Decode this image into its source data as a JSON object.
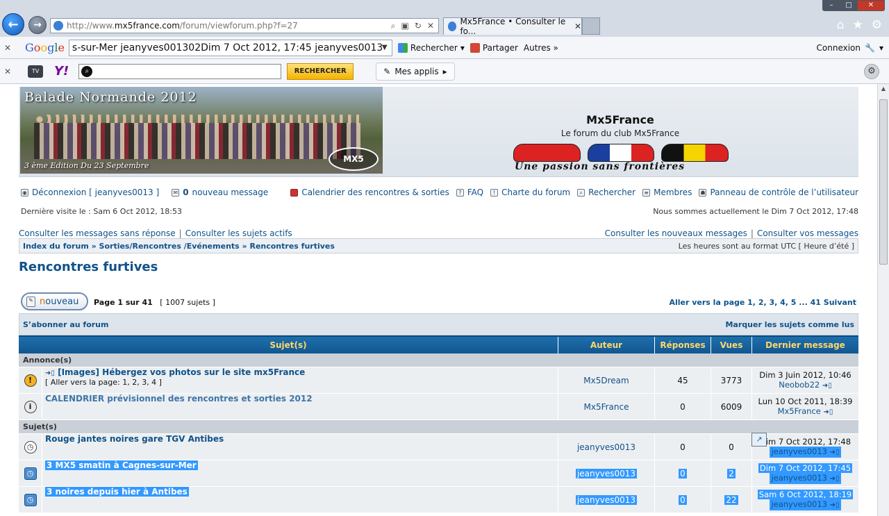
{
  "browser": {
    "url_prefix": "http://www.",
    "url_domain": "mx5france.com",
    "url_path": "/forum/viewforum.php?f=27",
    "tab_title": "Mx5France • Consulter le fo...",
    "google_search_value": "s-sur-Mer jeanyves001302Dim 7 Oct 2012, 17:45 jeanyves0013",
    "google_logo": [
      "G",
      "o",
      "o",
      "g",
      "l",
      "e"
    ],
    "toolbar_search_label": "Rechercher",
    "toolbar_share_label": "Partager",
    "toolbar_more_label": "Autres »",
    "toolbar_connexion_label": "Connexion",
    "yahoo_button_label": "RECHERCHER",
    "yahoo_apps_label": "Mes applis",
    "tv_label": "TV",
    "yahoo_label": "Y!"
  },
  "header": {
    "banner_title": "Balade Normande 2012",
    "banner_subtitle": "3 ème Edition Du 23 Septembre",
    "banner_logo": "MX5",
    "site_name": "Mx5France",
    "site_description": "Le forum du club Mx5France",
    "slogan": "Une passion sans frontières"
  },
  "nav": {
    "logout": "Déconnexion [ jeanyves0013 ]",
    "new_messages_count": "0",
    "new_messages_label": "nouveau message",
    "calendar": "Calendrier des rencontres & sorties",
    "faq": "FAQ",
    "charter": "Charte du forum",
    "search": "Rechercher",
    "members": "Membres",
    "ucp": "Panneau de contrôle de l’utilisateur",
    "last_visit": "Dernière visite le : Sam 6 Oct 2012, 18:53",
    "current_time": "Nous sommes actuellement le Dim 7 Oct 2012, 17:48",
    "unanswered": "Consulter les messages sans réponse",
    "active": "Consulter les sujets actifs",
    "new_posts": "Consulter les nouveaux messages",
    "your_posts": "Consulter vos messages"
  },
  "breadcrumb": {
    "path": "Index du forum » Sorties/Rencontres /Evénements » Rencontres furtives",
    "timezone": "Les heures sont au format UTC [ Heure d’été ]"
  },
  "forum": {
    "title": "Rencontres furtives",
    "new_topic_n": "n",
    "new_topic_rest": "ouveau",
    "page_label": "Page 1 sur 41",
    "topic_count": "[ 1007 sujets ]",
    "pagination": "Aller vers la page 1, 2, 3, 4, 5 ... 41  Suivant",
    "subscribe": "S’abonner au forum",
    "mark_read": "Marquer les sujets comme lus"
  },
  "table": {
    "columns": [
      "Sujet(s)",
      "Auteur",
      "Réponses",
      "Vues",
      "Dernier message"
    ],
    "announcements_label": "Annonce(s)",
    "topics_label": "Sujet(s)",
    "announcements": [
      {
        "title": "[Images] Hébergez vos photos sur le site mx5France",
        "pages": "[ Aller vers la page: 1, 2, 3, 4 ]",
        "author": "Mx5Dream",
        "replies": "45",
        "views": "3773",
        "last_date": "Dim 3 Juin 2012, 10:46",
        "last_by": "Neobob22"
      },
      {
        "title": "CALENDRIER prévisionnel des rencontres et sorties 2012",
        "author": "Mx5France",
        "replies": "0",
        "views": "6009",
        "last_date": "Lun 10 Oct 2011, 18:39",
        "last_by": "Mx5France"
      }
    ],
    "topics": [
      {
        "title": "Rouge jantes noires gare TGV Antibes",
        "author": "jeanyves0013",
        "replies": "0",
        "views": "0",
        "last_date": "Dim 7 Oct 2012, 17:48",
        "last_by": "jeanyves0013"
      },
      {
        "title": "3 MX5 smatin à Cagnes-sur-Mer",
        "author": "jeanyves0013",
        "replies": "0",
        "views": "2",
        "last_date": "Dim 7 Oct 2012, 17:45",
        "last_by": "jeanyves0013"
      },
      {
        "title": "3 noires depuis hier à Antibes",
        "author": "jeanyves0013",
        "replies": "0",
        "views": "22",
        "last_date": "Sam 6 Oct 2012, 18:19",
        "last_by": "jeanyves0013"
      }
    ]
  }
}
